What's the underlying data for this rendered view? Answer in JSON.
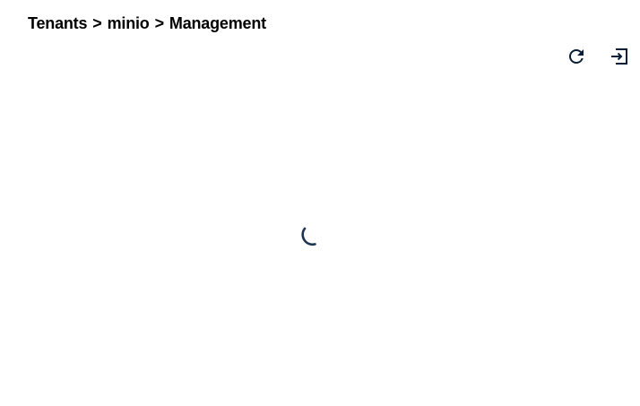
{
  "breadcrumb": {
    "items": [
      "Tenants",
      "minio",
      "Management"
    ],
    "separator": ">"
  },
  "toolbar": {
    "refresh_icon": "refresh-icon",
    "logout_icon": "logout-icon"
  },
  "content": {
    "state": "loading",
    "spinner_icon": "loading-spinner"
  },
  "colors": {
    "text": "#000000",
    "icon": "#071d35",
    "spinner": "#1c3553",
    "background": "#ffffff"
  }
}
